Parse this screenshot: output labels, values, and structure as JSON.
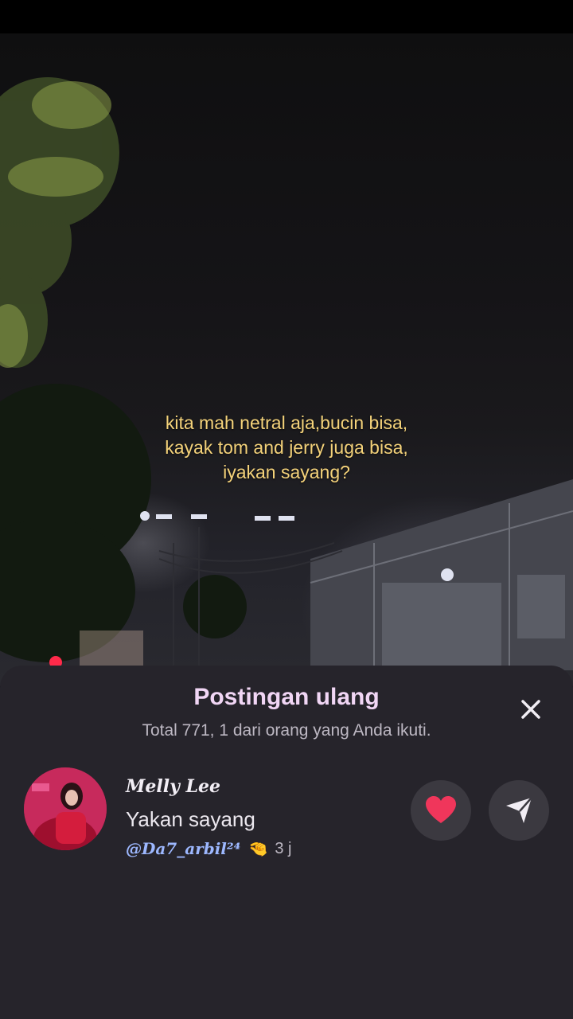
{
  "photo": {
    "caption_lines": [
      "kita mah netral aja,bucin bisa,",
      "kayak tom and jerry juga bisa,",
      "iyakan sayang?"
    ],
    "caption_color": "#f4d27a"
  },
  "repost_sheet": {
    "title": "Postingan ulang",
    "subtitle": "Total 771, 1 dari orang yang Anda ikuti.",
    "close_icon": "close-icon",
    "item": {
      "user_name": "Melly Lee",
      "comment": "Yakan sayang",
      "mention": "@Da7_arbil²⁴",
      "emoji": "🤏",
      "time": "3 j",
      "like_icon": "heart-icon",
      "like_color": "#f0365b",
      "send_icon": "send-icon"
    }
  }
}
